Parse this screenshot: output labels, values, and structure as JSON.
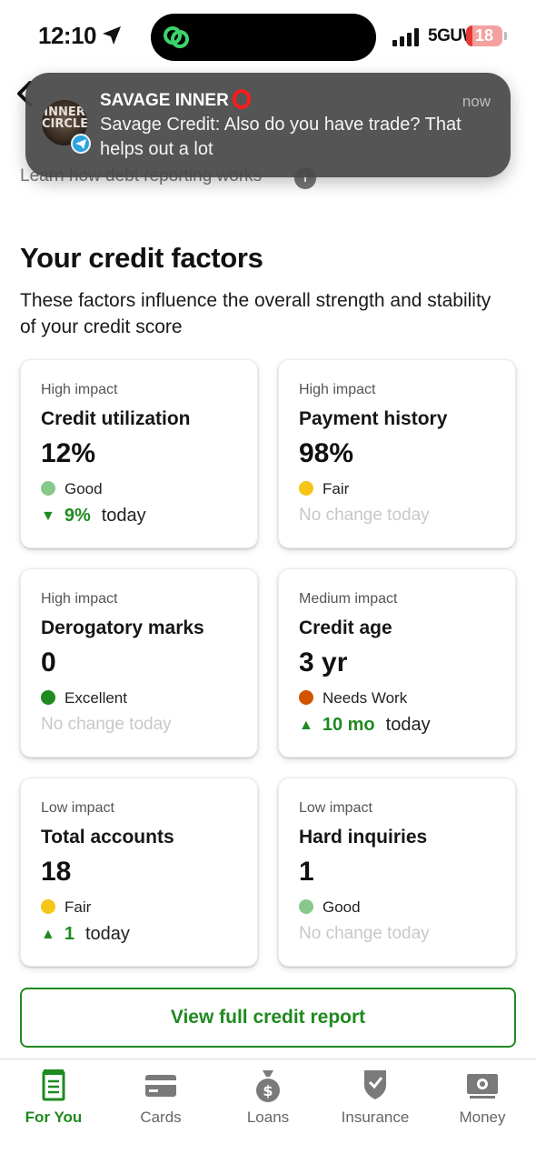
{
  "status_bar": {
    "time": "12:10",
    "network": "5GUW",
    "battery": "18",
    "battery_level": 0.18
  },
  "colors": {
    "accent": "#1f8a1f",
    "good": "#86c98a",
    "fair": "#f5c518",
    "excellent": "#1f8a1f",
    "needs_work": "#d35400",
    "muted": "#c8c8c8"
  },
  "page": {
    "debt_link": "Learn how debt reporting works"
  },
  "notification": {
    "app_icon": "telegram-icon",
    "title": "SAVAGE INNER",
    "avatar_text": "INNER CIRCLE",
    "time": "now",
    "body": "Savage Credit: Also do you have trade? That helps out a lot"
  },
  "section": {
    "title": "Your credit factors",
    "subtitle": "These factors influence the overall strength and stability of your credit score"
  },
  "factors": [
    {
      "impact": "High impact",
      "name": "Credit utilization",
      "value": "12%",
      "rating": "Good",
      "change_dir": "down",
      "change_amount": "9%",
      "change_suffix": "today"
    },
    {
      "impact": "High impact",
      "name": "Payment history",
      "value": "98%",
      "rating": "Fair",
      "change_text": "No change today"
    },
    {
      "impact": "High impact",
      "name": "Derogatory marks",
      "value": "0",
      "rating": "Excellent",
      "change_text": "No change today"
    },
    {
      "impact": "Medium impact",
      "name": "Credit age",
      "value": "3 yr",
      "rating": "Needs Work",
      "change_dir": "up",
      "change_amount": "10 mo",
      "change_suffix": "today"
    },
    {
      "impact": "Low impact",
      "name": "Total accounts",
      "value": "18",
      "rating": "Fair",
      "change_dir": "up",
      "change_amount": "1",
      "change_suffix": "today"
    },
    {
      "impact": "Low impact",
      "name": "Hard inquiries",
      "value": "1",
      "rating": "Good",
      "change_text": "No change today"
    }
  ],
  "report_button": "View full credit report",
  "tabs": [
    {
      "label": "For You",
      "icon": "document-icon",
      "active": true
    },
    {
      "label": "Cards",
      "icon": "card-icon"
    },
    {
      "label": "Loans",
      "icon": "money-bag-icon"
    },
    {
      "label": "Insurance",
      "icon": "shield-check-icon"
    },
    {
      "label": "Money",
      "icon": "cash-icon"
    }
  ]
}
